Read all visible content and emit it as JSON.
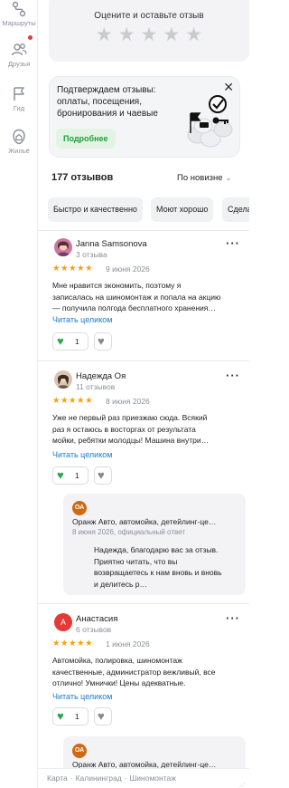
{
  "rail": {
    "items": [
      {
        "label": "Маршруты",
        "icon": "route-icon"
      },
      {
        "label": "Друзья",
        "icon": "friends-icon"
      },
      {
        "label": "Гид",
        "icon": "guide-flag-icon"
      },
      {
        "label": "Жильё",
        "icon": "housing-icon"
      }
    ]
  },
  "rate": {
    "title": "Оцените и оставьте отзыв",
    "stars_total": 5
  },
  "promo": {
    "lines": [
      "Подтверждаем отзывы:",
      "оплаты, посещения,",
      "бронирования и чаевые"
    ],
    "button": "Подробнее",
    "close": "✕"
  },
  "reviews_header": {
    "count": "177 отзывов",
    "sort": "По новизне"
  },
  "chips": [
    "Быстро и качественно",
    "Моют хорошо",
    "Сдела"
  ],
  "reviews": [
    {
      "name": "Janna Samsonova",
      "sub": "3 отзыва",
      "stars": "★★★★★",
      "rating": 5,
      "date": "9 июня 2026",
      "text_lines": [
        "Мне нравится экономить, поэтому я",
        "записалась на шиномонтаж и попала на акцию",
        "— получила полгода бесплатного хранения…"
      ],
      "more": "Читать целиком",
      "likes": "1"
    },
    {
      "name": "Надежда Оя",
      "sub": "11 отзывов",
      "stars": "★★★★★",
      "rating": 5,
      "date": "8 июня 2026",
      "text_lines": [
        "Уже не первый раз приезжаю сюда. Всякий",
        "раз я остаюсь в восторгах от результата",
        "мойки, ребятки молодцы! Машина внутри…"
      ],
      "more": "Читать целиком",
      "likes": "1",
      "reply": {
        "logo": "ОА",
        "org": "Оранж Авто, автомойка, детейлинг-це…",
        "date": "8 июня 2026, официальный ответ",
        "text_lines": [
          "Надежда, благодарю вас за отзыв.",
          "Приятно читать, что вы",
          "возвращаетесь к нам вновь и вновь",
          "и делитесь р…"
        ]
      }
    },
    {
      "name": "Анастасия",
      "initial": "А",
      "sub": "6 отзывов",
      "stars": "★★★★★",
      "rating": 5,
      "date": "1 июня 2026",
      "text_lines": [
        "Автомойка, полировка, шиномонтаж",
        "качественные, администратор вежливый, все",
        "отлично! Умнички! Цены адекватные."
      ],
      "more": "Читать целиком",
      "likes": "1",
      "reply": {
        "logo": "ОА",
        "org": "Оранж Авто, автомойка, детейлинг-це…"
      }
    }
  ],
  "footer": {
    "crumbs": [
      "Карта",
      "Калининград",
      "Шиномонтаж"
    ],
    "sep": "·"
  },
  "colors": {
    "accent_green": "#2ea44f",
    "link_blue": "#1e7cc7",
    "star_orange": "#f4a20c",
    "notif_red": "#e53935"
  }
}
